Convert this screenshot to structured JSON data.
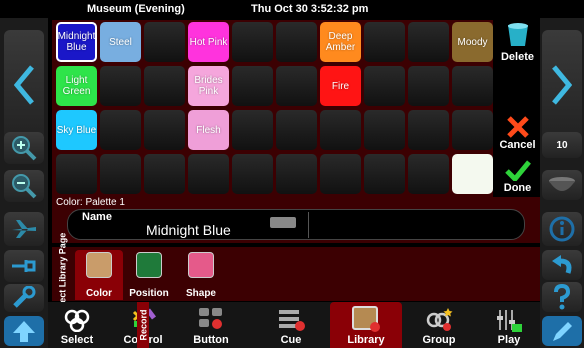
{
  "topbar": {
    "venue": "Museum (Evening)",
    "clock": "Thu Oct 30 3:52:32 pm"
  },
  "grid": {
    "cells": [
      {
        "row": 0,
        "col": 0,
        "label": "Midnight Blue",
        "color": "#1a17c8",
        "selected": true
      },
      {
        "row": 0,
        "col": 1,
        "label": "Steel",
        "color": "#78aee0"
      },
      {
        "row": 0,
        "col": 3,
        "label": "Hot Pink",
        "color": "#ff33dd"
      },
      {
        "row": 0,
        "col": 6,
        "label": "Deep Amber",
        "color": "#ff8a1e"
      },
      {
        "row": 0,
        "col": 9,
        "label": "Moody",
        "color": "#8a6a2e"
      },
      {
        "row": 1,
        "col": 0,
        "label": "Light Green",
        "color": "#2ee44a"
      },
      {
        "row": 1,
        "col": 3,
        "label": "Brides Pink",
        "color": "#f5a6dc"
      },
      {
        "row": 1,
        "col": 6,
        "label": "Fire",
        "color": "#ff1414"
      },
      {
        "row": 2,
        "col": 0,
        "label": "Sky Blue",
        "color": "#1ec8ff"
      },
      {
        "row": 2,
        "col": 3,
        "label": "Flesh",
        "color": "#ef9fd8"
      },
      {
        "row": 3,
        "col": 9,
        "label": "",
        "color": "#f4f9ef"
      }
    ]
  },
  "actions": {
    "delete": "Delete",
    "cancel": "Cancel",
    "done": "Done",
    "counter": "10"
  },
  "palette": {
    "title": "Color: Palette 1",
    "name_label": "Name",
    "name_value": "Midnight Blue"
  },
  "library": {
    "side_label": "Select Library Page",
    "tabs": [
      {
        "label": "Color",
        "icon": "color-brush-icon",
        "active": true
      },
      {
        "label": "Position",
        "icon": "position-icon"
      },
      {
        "label": "Shape",
        "icon": "shape-icon"
      }
    ]
  },
  "bottom": {
    "record_label": "Record",
    "tabs": [
      {
        "label": "Select",
        "icon": "select-rings-icon"
      },
      {
        "label": "Control",
        "icon": "control-icon"
      },
      {
        "label": "Button",
        "icon": "button-icon"
      },
      {
        "label": "Cue",
        "icon": "cue-icon"
      },
      {
        "label": "Library",
        "icon": "library-icon",
        "active": true
      },
      {
        "label": "Group",
        "icon": "group-icon"
      },
      {
        "label": "Play",
        "icon": "play-icon"
      }
    ]
  },
  "colors": {
    "accent_red": "#3c0002",
    "active_tab": "#8a0006"
  }
}
